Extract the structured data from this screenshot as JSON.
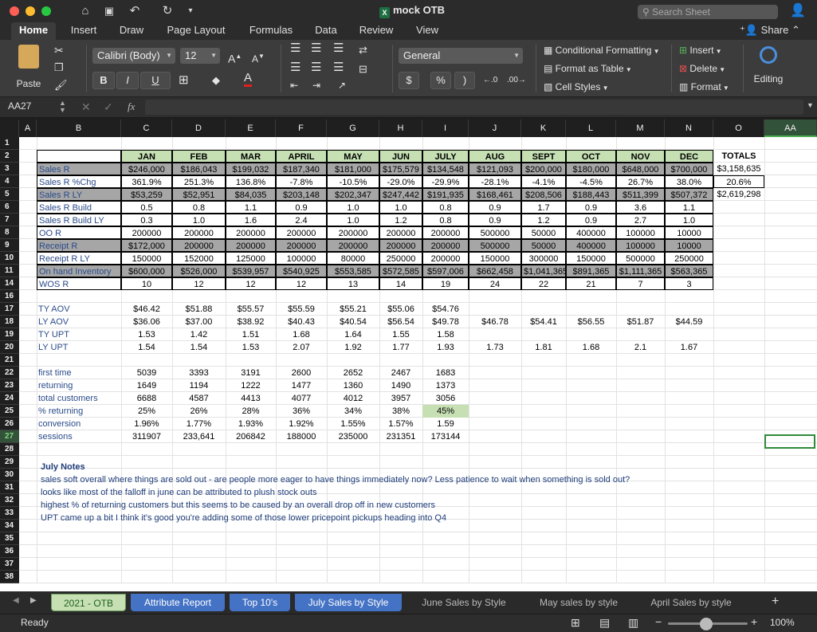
{
  "window": {
    "title": "mock OTB",
    "search_placeholder": "Search Sheet"
  },
  "ribbon_tabs": [
    "Home",
    "Insert",
    "Draw",
    "Page Layout",
    "Formulas",
    "Data",
    "Review",
    "View"
  ],
  "share_label": "Share",
  "ribbon": {
    "paste": "Paste",
    "font_name": "Calibri (Body)",
    "font_size": "12",
    "number_format": "General",
    "currency": "$",
    "percent": "%",
    "comma": ")",
    "conditional_formatting": "Conditional Formatting",
    "format_as_table": "Format as Table",
    "cell_styles": "Cell Styles",
    "insert": "Insert",
    "delete": "Delete",
    "format": "Format",
    "editing": "Editing",
    "bold": "B",
    "italic": "I",
    "underline": "U"
  },
  "formula_bar": {
    "name_box": "AA27",
    "fx": "fx",
    "formula": ""
  },
  "columns": [
    "A",
    "B",
    "C",
    "D",
    "E",
    "F",
    "G",
    "H",
    "I",
    "J",
    "K",
    "L",
    "M",
    "N",
    "O",
    "AA"
  ],
  "rows": [
    "1",
    "2",
    "3",
    "4",
    "5",
    "6",
    "7",
    "8",
    "9",
    "10",
    "11",
    "14",
    "16",
    "17",
    "18",
    "19",
    "20",
    "21",
    "22",
    "23",
    "24",
    "25",
    "26",
    "27",
    "28",
    "29",
    "30",
    "31",
    "32",
    "33",
    "34",
    "35",
    "36",
    "37",
    "38"
  ],
  "months": [
    "JAN",
    "FEB",
    "MAR",
    "APRIL",
    "MAY",
    "JUN",
    "JULY",
    "AUG",
    "SEPT",
    "OCT",
    "NOV",
    "DEC"
  ],
  "totals_header": "TOTALS",
  "table": [
    {
      "label": "Sales R",
      "shade": "gray",
      "values": [
        "$246,000",
        "$186,043",
        "$199,032",
        "$187,340",
        "$181,000",
        "$175,579",
        "$134,548",
        "$121,093",
        "$200,000",
        "$180,000",
        "$648,000",
        "$700,000"
      ],
      "total": "$3,158,635"
    },
    {
      "label": "Sales R %Chg",
      "shade": "",
      "values": [
        "361.9%",
        "251.3%",
        "136.8%",
        "-7.8%",
        "-10.5%",
        "-29.0%",
        "-29.9%",
        "-28.1%",
        "-4.1%",
        "-4.5%",
        "26.7%",
        "38.0%"
      ],
      "total": "20.6%"
    },
    {
      "label": "Sales R LY",
      "shade": "gray",
      "values": [
        "$53,259",
        "$52,951",
        "$84,035",
        "$203,148",
        "$202,347",
        "$247,442",
        "$191,935",
        "$168,461",
        "$208,506",
        "$188,443",
        "$511,399",
        "$507,372"
      ],
      "total": "$2,619,298"
    },
    {
      "label": "Sales R Build",
      "shade": "",
      "values": [
        "0.5",
        "0.8",
        "1.1",
        "0.9",
        "1.0",
        "1.0",
        "0.8",
        "0.9",
        "1.7",
        "0.9",
        "3.6",
        "1.1"
      ],
      "total": ""
    },
    {
      "label": "Sales R Build LY",
      "shade": "",
      "values": [
        "0.3",
        "1.0",
        "1.6",
        "2.4",
        "1.0",
        "1.2",
        "0.8",
        "0.9",
        "1.2",
        "0.9",
        "2.7",
        "1.0"
      ],
      "total": ""
    },
    {
      "label": "OO R",
      "shade": "",
      "values": [
        "200000",
        "200000",
        "200000",
        "200000",
        "200000",
        "200000",
        "200000",
        "500000",
        "50000",
        "400000",
        "100000",
        "10000"
      ],
      "total": ""
    },
    {
      "label": "Receipt R",
      "shade": "gray",
      "values": [
        "$172,000",
        "200000",
        "200000",
        "200000",
        "200000",
        "200000",
        "200000",
        "500000",
        "50000",
        "400000",
        "100000",
        "10000"
      ],
      "total": ""
    },
    {
      "label": "Receipt R LY",
      "shade": "",
      "values": [
        "150000",
        "152000",
        "125000",
        "100000",
        "80000",
        "250000",
        "200000",
        "150000",
        "300000",
        "150000",
        "500000",
        "250000"
      ],
      "total": ""
    },
    {
      "label": "On hand Inventory",
      "shade": "gray",
      "values": [
        "$600,000",
        "$526,000",
        "$539,957",
        "$540,925",
        "$553,585",
        "$572,585",
        "$597,006",
        "$662,458",
        "$1,041,365",
        "$891,365",
        "$1,111,365",
        "$563,365"
      ],
      "total": ""
    },
    {
      "label": "WOS R",
      "shade": "",
      "values": [
        "10",
        "12",
        "12",
        "12",
        "13",
        "14",
        "19",
        "24",
        "22",
        "21",
        "7",
        "3"
      ],
      "total": ""
    }
  ],
  "aov_block": [
    {
      "label": "TY AOV",
      "values": [
        "$46.42",
        "$51.88",
        "$55.57",
        "$55.59",
        "$55.21",
        "$55.06",
        "$54.76",
        "",
        "",
        "",
        "",
        ""
      ]
    },
    {
      "label": "LY AOV",
      "values": [
        "$36.06",
        "$37.00",
        "$38.92",
        "$40.43",
        "$40.54",
        "$56.54",
        "$49.78",
        "$46.78",
        "$54.41",
        "$56.55",
        "$51.87",
        "$44.59"
      ]
    },
    {
      "label": "TY UPT",
      "values": [
        "1.53",
        "1.42",
        "1.51",
        "1.68",
        "1.64",
        "1.55",
        "1.58",
        "",
        "",
        "",
        "",
        ""
      ]
    },
    {
      "label": "LY UPT",
      "values": [
        "1.54",
        "1.54",
        "1.53",
        "2.07",
        "1.92",
        "1.77",
        "1.93",
        "1.73",
        "1.81",
        "1.68",
        "2.1",
        "1.67"
      ]
    }
  ],
  "customer_block": [
    {
      "label": "first time",
      "values": [
        "5039",
        "3393",
        "3191",
        "2600",
        "2652",
        "2467",
        "1683"
      ]
    },
    {
      "label": "returning",
      "values": [
        "1649",
        "1194",
        "1222",
        "1477",
        "1360",
        "1490",
        "1373"
      ]
    },
    {
      "label": "total customers",
      "values": [
        "6688",
        "4587",
        "4413",
        "4077",
        "4012",
        "3957",
        "3056"
      ]
    },
    {
      "label": "% returning",
      "values": [
        "25%",
        "26%",
        "28%",
        "36%",
        "34%",
        "38%",
        "45%"
      ]
    },
    {
      "label": "conversion",
      "values": [
        "1.96%",
        "1.77%",
        "1.93%",
        "1.92%",
        "1.55%",
        "1.57%",
        "1.59"
      ]
    },
    {
      "label": "sessions",
      "values": [
        "311907",
        "233,641",
        "206842",
        "188000",
        "235000",
        "231351",
        "173144"
      ]
    }
  ],
  "notes": {
    "title": "July Notes",
    "lines": [
      "sales soft overall where things are sold out - are people more eager to have things immediately now?  Less patience to wait when something is sold out?",
      "looks like most of the falloff in june can be attributed to plush stock outs",
      "highest % of returning customers but this seems to be caused by an overall drop off in new customers",
      "UPT came up a bit I think it's good you're adding some of those lower pricepoint pickups heading into Q4"
    ]
  },
  "sheet_tabs": [
    "2021 - OTB",
    "Attribute Report",
    "Top 10's",
    "July Sales by Style",
    "June Sales by Style",
    "May sales by style",
    "April Sales by style"
  ],
  "status": {
    "ready": "Ready",
    "zoom": "100%"
  }
}
